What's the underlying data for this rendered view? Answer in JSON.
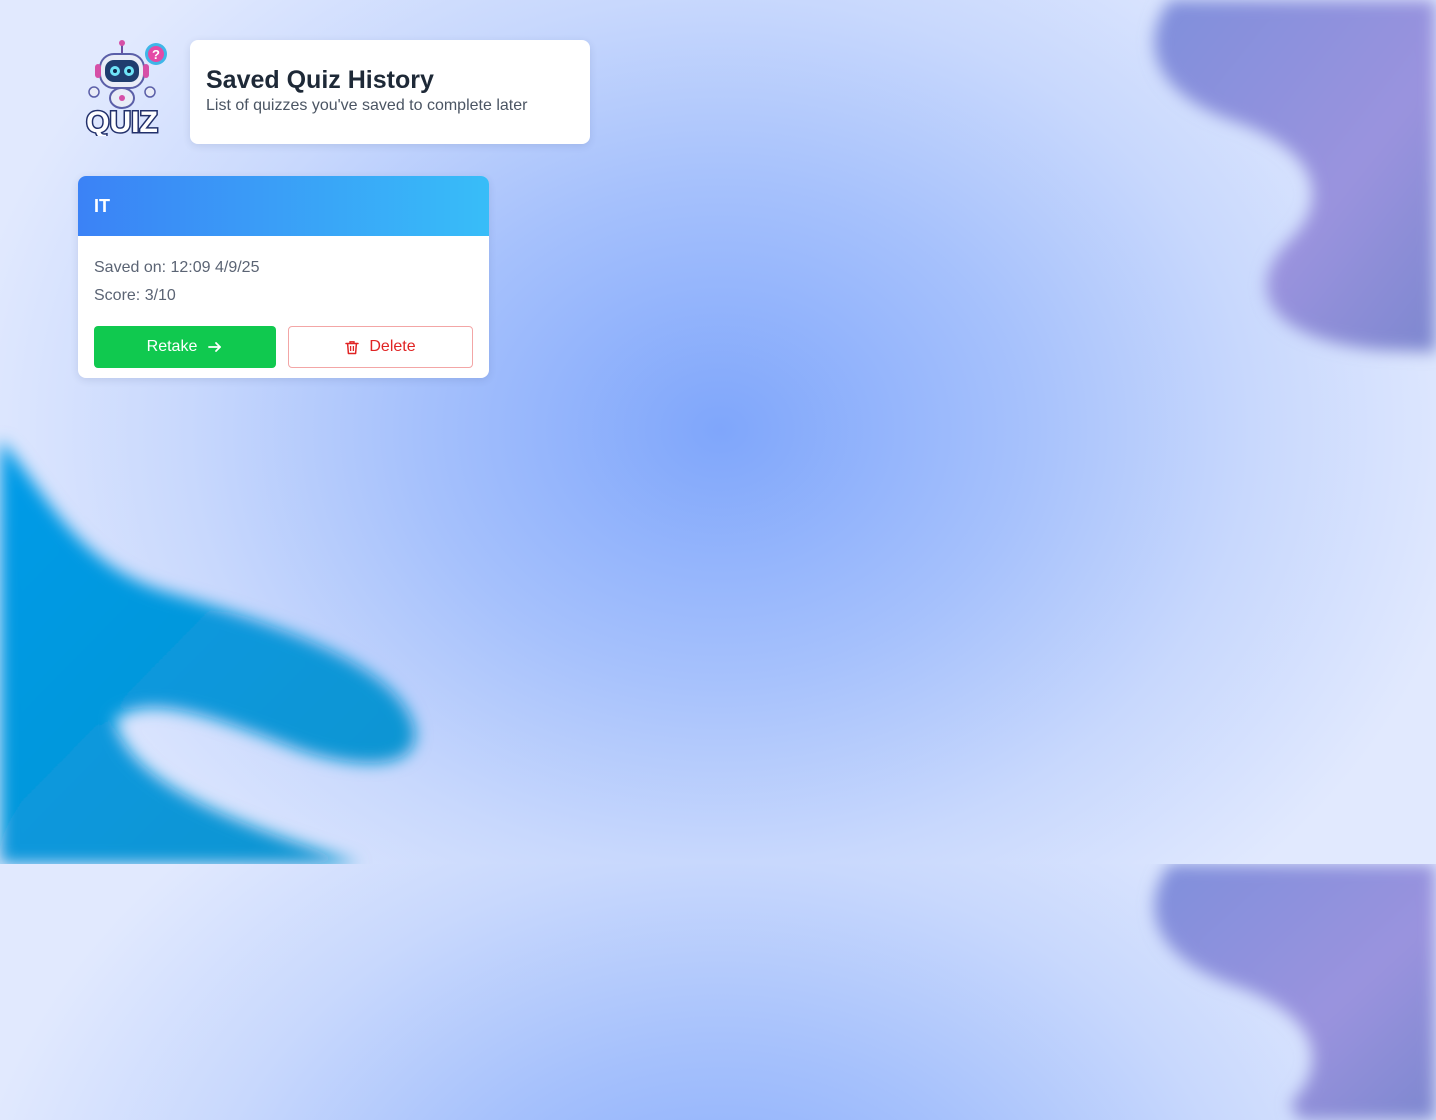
{
  "colors": {
    "accent": "#3b82f6",
    "accent_end": "#38bdf8",
    "retake": "#10c94f",
    "delete": "#e02424",
    "title": "#1e2937",
    "text_muted": "#5b6474"
  },
  "logo": {
    "text": "QUIZ",
    "icon": "robot-mascot-icon"
  },
  "header": {
    "title": "Saved Quiz History",
    "subtitle": "List of quizzes you've saved to complete later"
  },
  "quizzes": [
    {
      "topic": "IT",
      "saved_on": "Saved on: 12:09 4/9/25",
      "score": "Score: 3/10",
      "retake_label": "Retake",
      "retake_icon": "arrow-right-icon",
      "delete_label": "Delete",
      "delete_icon": "trash-icon"
    }
  ]
}
